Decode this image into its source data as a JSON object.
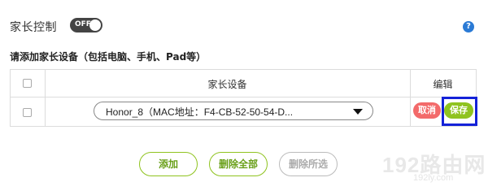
{
  "header": {
    "title": "家长控制",
    "toggle_label": "OFF",
    "help_label": "?"
  },
  "section": {
    "subtitle": "请添加家长设备（包括电脑、手机、Pad等）"
  },
  "table": {
    "columns": [
      "家长设备",
      "编辑"
    ],
    "row": {
      "device_value": "Honor_8（MAC地址：F4-CB-52-50-54-D...",
      "cancel_label": "取消",
      "save_label": "保存"
    }
  },
  "actions": {
    "add_label": "添加",
    "delete_all_label": "删除全部",
    "delete_selected_label": "删除所选"
  },
  "watermark": {
    "big": "192路由网",
    "small": "192ly.com"
  },
  "colors": {
    "accent_green": "#8fc31f",
    "cancel_red": "#f36a6a",
    "focus_blue": "#1422d8",
    "help_blue": "#2a7ad5"
  }
}
